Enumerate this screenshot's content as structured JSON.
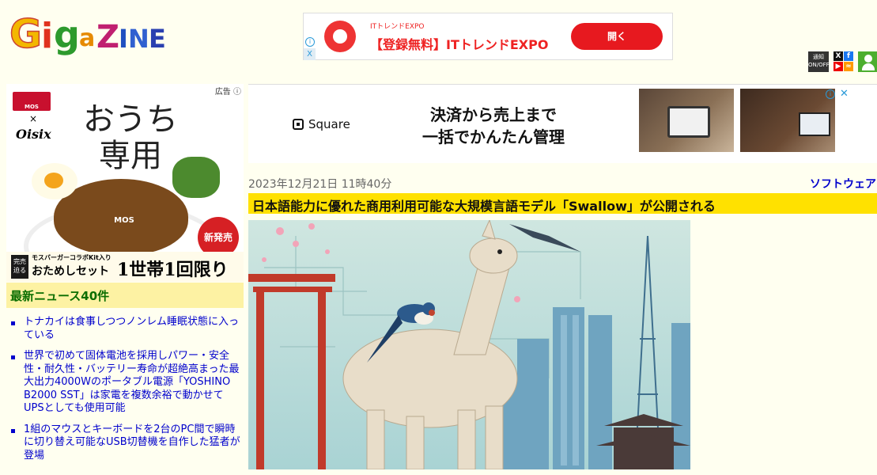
{
  "site": {
    "logo_text": "GigaZINE"
  },
  "top_ad": {
    "small": "ITトレンドEXPO",
    "title": "【登録無料】ITトレンドEXPO",
    "button": "開く",
    "info": "i",
    "close": "X"
  },
  "header_icons": {
    "notify_label": "通知",
    "notify_sub": "ON/OFF"
  },
  "side_ad": {
    "label": "広告 ⓘ",
    "brand1": "MOS BURGER",
    "cross": "×",
    "brand2": "Oisix",
    "headline": "おうち専用",
    "food_mark": "MOS BURGER",
    "new_badge": "新発売",
    "limit": "完売迫る",
    "sub": "モスバーガーコラボKit入り",
    "set": "おためしセット",
    "once": "1世帯1回限り"
  },
  "news": {
    "header": "最新ニュース40件",
    "items": [
      "トナカイは食事しつつノンレム睡眠状態に入っている",
      "世界で初めて固体電池を採用しパワー・安全性・耐久性・バッテリー寿命が超絶高まった最大出力4000Wのポータブル電源「YOSHINO B2000 SST」は家電を複数余裕で動かせてUPSとしても使用可能",
      "1組のマウスとキーボードを2台のPC間で瞬時に切り替え可能なUSB切替機を自作した猛者が登場"
    ]
  },
  "banner": {
    "brand": "Square",
    "tagline_line1": "決済から売上まで",
    "tagline_line2": "一括でかんたん管理",
    "info": "i",
    "close": "✕"
  },
  "article": {
    "date": "2023年12月21日 11時40分",
    "category": "ソフトウェア",
    "title": "日本語能力に優れた商用利用可能な大規模言語モデル「Swallow」が公開される"
  },
  "colors": {
    "page_bg": "#fffff0",
    "title_bar": "#ffe100",
    "news_header_bg": "#fdf2a3",
    "news_header_text": "#0a6e00",
    "link": "#0000cc"
  }
}
